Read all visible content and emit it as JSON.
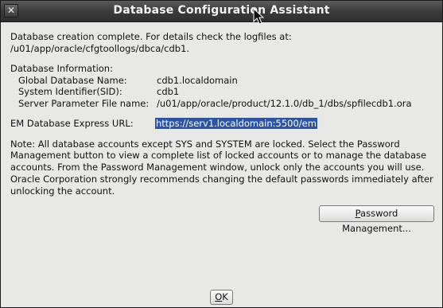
{
  "window": {
    "title": "Database Configuration Assistant",
    "close_glyph": "✕"
  },
  "message": {
    "complete_line": "Database creation complete. For details check the logfiles at:",
    "log_path": " /u01/app/oracle/cfgtoollogs/dbca/cdb1.",
    "info_heading": "Database Information:",
    "fields": [
      {
        "label": "Global Database Name:",
        "value": "cdb1.localdomain"
      },
      {
        "label": "System Identifier(SID):",
        "value": "cdb1"
      },
      {
        "label": "Server Parameter File name:",
        "value": "/u01/app/oracle/product/12.1.0/db_1/dbs/spfilecdb1.ora"
      }
    ],
    "em_label": "EM Database Express URL:",
    "em_url": "https://serv1.localdomain:5500/em",
    "note_lines": [
      "Note: All database accounts except SYS and SYSTEM are locked. Select the Password",
      "Management button to view a complete list of locked accounts or to manage the database",
      "accounts. From the Password Management window, unlock only the accounts you will use.",
      "Oracle Corporation strongly recommends changing the default passwords immediately after",
      "unlocking the account."
    ]
  },
  "buttons": {
    "password_mnemonic": "P",
    "password_rest": "assword Management...",
    "ok_mnemonic": "O",
    "ok_rest": "K"
  }
}
